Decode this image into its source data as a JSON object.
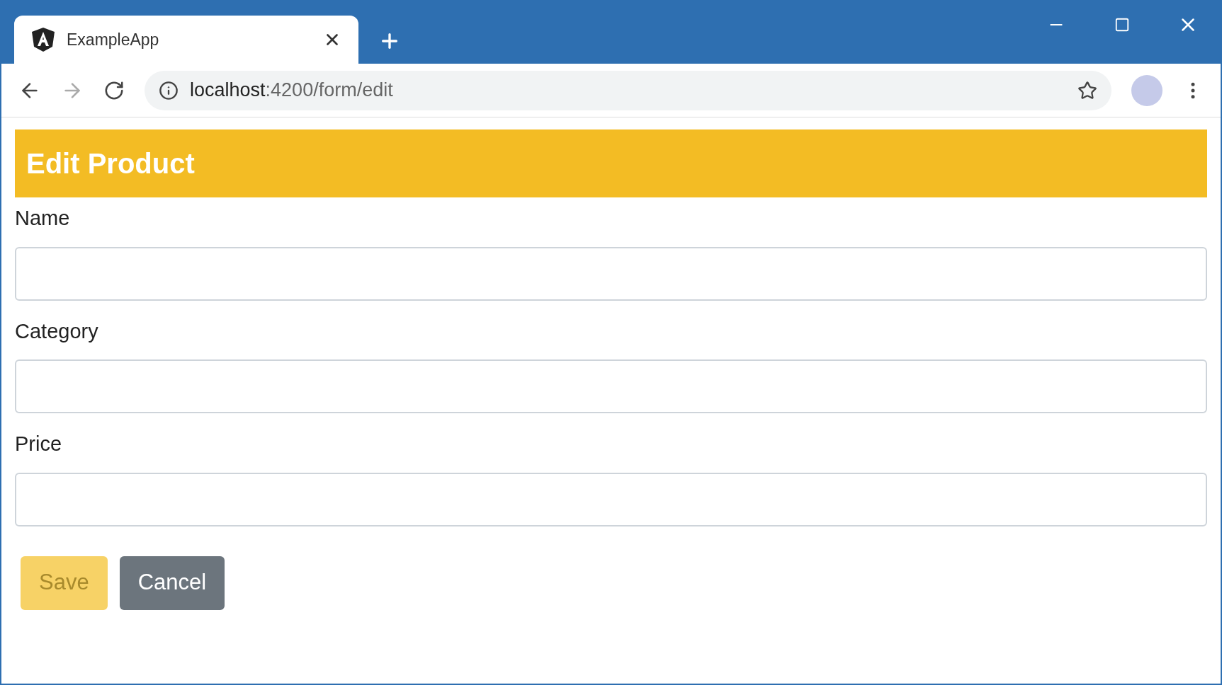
{
  "browser": {
    "tabs": [
      {
        "title": "ExampleApp",
        "selected": true
      }
    ],
    "forward_disabled": true,
    "url_host": "localhost",
    "url_rest": ":4200/form/edit"
  },
  "page": {
    "title": "Edit Product",
    "fields": [
      {
        "label": "Name"
      },
      {
        "label": "Category"
      },
      {
        "label": "Price"
      }
    ],
    "buttons": [
      {
        "label": "Save",
        "kind": "primary",
        "disabled": true
      },
      {
        "label": "Cancel",
        "kind": "secondary",
        "disabled": false
      }
    ]
  }
}
